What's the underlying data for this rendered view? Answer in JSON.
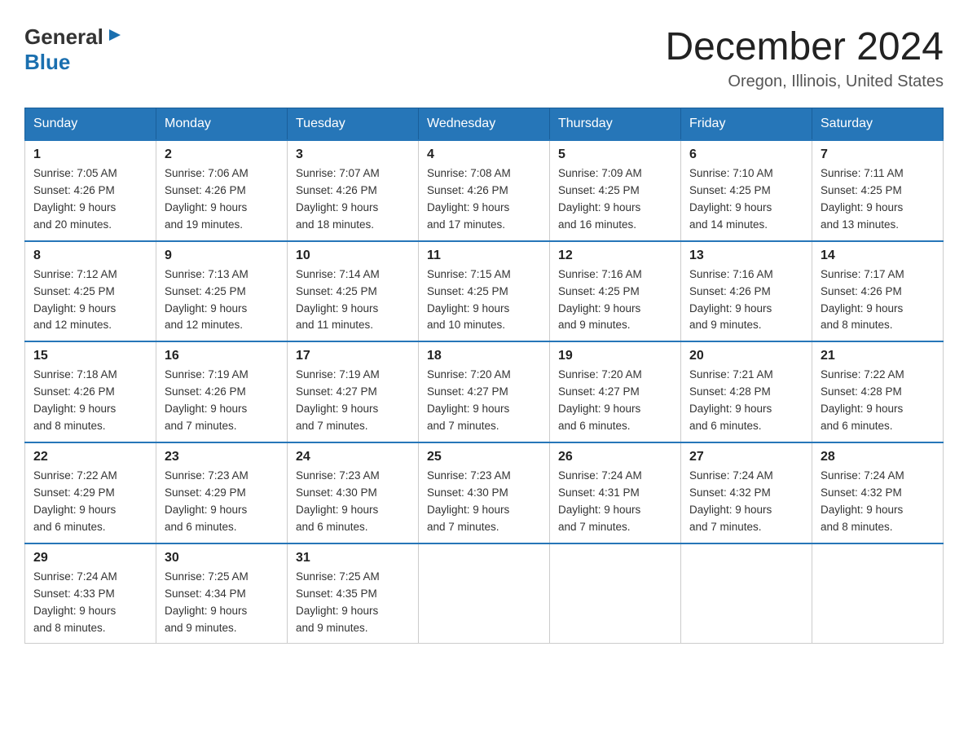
{
  "header": {
    "logo_general": "General",
    "logo_blue": "Blue",
    "month_title": "December 2024",
    "location": "Oregon, Illinois, United States"
  },
  "days_of_week": [
    "Sunday",
    "Monday",
    "Tuesday",
    "Wednesday",
    "Thursday",
    "Friday",
    "Saturday"
  ],
  "weeks": [
    [
      {
        "day": "1",
        "sunrise": "7:05 AM",
        "sunset": "4:26 PM",
        "daylight": "9 hours and 20 minutes."
      },
      {
        "day": "2",
        "sunrise": "7:06 AM",
        "sunset": "4:26 PM",
        "daylight": "9 hours and 19 minutes."
      },
      {
        "day": "3",
        "sunrise": "7:07 AM",
        "sunset": "4:26 PM",
        "daylight": "9 hours and 18 minutes."
      },
      {
        "day": "4",
        "sunrise": "7:08 AM",
        "sunset": "4:26 PM",
        "daylight": "9 hours and 17 minutes."
      },
      {
        "day": "5",
        "sunrise": "7:09 AM",
        "sunset": "4:25 PM",
        "daylight": "9 hours and 16 minutes."
      },
      {
        "day": "6",
        "sunrise": "7:10 AM",
        "sunset": "4:25 PM",
        "daylight": "9 hours and 14 minutes."
      },
      {
        "day": "7",
        "sunrise": "7:11 AM",
        "sunset": "4:25 PM",
        "daylight": "9 hours and 13 minutes."
      }
    ],
    [
      {
        "day": "8",
        "sunrise": "7:12 AM",
        "sunset": "4:25 PM",
        "daylight": "9 hours and 12 minutes."
      },
      {
        "day": "9",
        "sunrise": "7:13 AM",
        "sunset": "4:25 PM",
        "daylight": "9 hours and 12 minutes."
      },
      {
        "day": "10",
        "sunrise": "7:14 AM",
        "sunset": "4:25 PM",
        "daylight": "9 hours and 11 minutes."
      },
      {
        "day": "11",
        "sunrise": "7:15 AM",
        "sunset": "4:25 PM",
        "daylight": "9 hours and 10 minutes."
      },
      {
        "day": "12",
        "sunrise": "7:16 AM",
        "sunset": "4:25 PM",
        "daylight": "9 hours and 9 minutes."
      },
      {
        "day": "13",
        "sunrise": "7:16 AM",
        "sunset": "4:26 PM",
        "daylight": "9 hours and 9 minutes."
      },
      {
        "day": "14",
        "sunrise": "7:17 AM",
        "sunset": "4:26 PM",
        "daylight": "9 hours and 8 minutes."
      }
    ],
    [
      {
        "day": "15",
        "sunrise": "7:18 AM",
        "sunset": "4:26 PM",
        "daylight": "9 hours and 8 minutes."
      },
      {
        "day": "16",
        "sunrise": "7:19 AM",
        "sunset": "4:26 PM",
        "daylight": "9 hours and 7 minutes."
      },
      {
        "day": "17",
        "sunrise": "7:19 AM",
        "sunset": "4:27 PM",
        "daylight": "9 hours and 7 minutes."
      },
      {
        "day": "18",
        "sunrise": "7:20 AM",
        "sunset": "4:27 PM",
        "daylight": "9 hours and 7 minutes."
      },
      {
        "day": "19",
        "sunrise": "7:20 AM",
        "sunset": "4:27 PM",
        "daylight": "9 hours and 6 minutes."
      },
      {
        "day": "20",
        "sunrise": "7:21 AM",
        "sunset": "4:28 PM",
        "daylight": "9 hours and 6 minutes."
      },
      {
        "day": "21",
        "sunrise": "7:22 AM",
        "sunset": "4:28 PM",
        "daylight": "9 hours and 6 minutes."
      }
    ],
    [
      {
        "day": "22",
        "sunrise": "7:22 AM",
        "sunset": "4:29 PM",
        "daylight": "9 hours and 6 minutes."
      },
      {
        "day": "23",
        "sunrise": "7:23 AM",
        "sunset": "4:29 PM",
        "daylight": "9 hours and 6 minutes."
      },
      {
        "day": "24",
        "sunrise": "7:23 AM",
        "sunset": "4:30 PM",
        "daylight": "9 hours and 6 minutes."
      },
      {
        "day": "25",
        "sunrise": "7:23 AM",
        "sunset": "4:30 PM",
        "daylight": "9 hours and 7 minutes."
      },
      {
        "day": "26",
        "sunrise": "7:24 AM",
        "sunset": "4:31 PM",
        "daylight": "9 hours and 7 minutes."
      },
      {
        "day": "27",
        "sunrise": "7:24 AM",
        "sunset": "4:32 PM",
        "daylight": "9 hours and 7 minutes."
      },
      {
        "day": "28",
        "sunrise": "7:24 AM",
        "sunset": "4:32 PM",
        "daylight": "9 hours and 8 minutes."
      }
    ],
    [
      {
        "day": "29",
        "sunrise": "7:24 AM",
        "sunset": "4:33 PM",
        "daylight": "9 hours and 8 minutes."
      },
      {
        "day": "30",
        "sunrise": "7:25 AM",
        "sunset": "4:34 PM",
        "daylight": "9 hours and 9 minutes."
      },
      {
        "day": "31",
        "sunrise": "7:25 AM",
        "sunset": "4:35 PM",
        "daylight": "9 hours and 9 minutes."
      },
      null,
      null,
      null,
      null
    ]
  ]
}
